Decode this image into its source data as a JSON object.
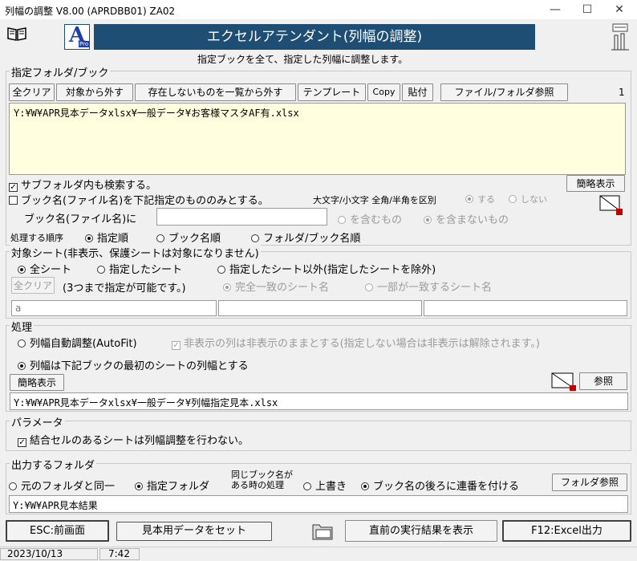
{
  "window": {
    "title": "列幅の調整 V8.00 (APRDBB01)  ZA02",
    "minimize": "—",
    "maximize": "☐",
    "close": "✕"
  },
  "header": {
    "banner": "エクセルアテンダント(列幅の調整)",
    "subtitle": "指定ブックを全て、指定した列幅に調整します。",
    "logo_letter": "A",
    "logo_sub": "Pro"
  },
  "books": {
    "group_label": "指定フォルダ/ブック",
    "btn_clear": "全クリア",
    "btn_remove": "対象から外す",
    "btn_remove_missing": "存在しないものを一覧から外す",
    "btn_template": "テンプレート",
    "btn_copy": "Copy",
    "btn_paste": "貼付",
    "btn_browse": "ファイル/フォルダ参照",
    "count": "1",
    "list": [
      "Y:¥W¥APR見本データxlsx¥一般データ¥お客様マスタAF有.xlsx"
    ],
    "subfolder_label": "サブフォルダ内も検索する。",
    "subfolder_checked": true,
    "btn_simple": "簡略表示",
    "filter_label": "ブック名(ファイル名)を下記指定のもののみとする。",
    "case_label": "大文字/小文字 全角/半角を区別",
    "case_yes": "する",
    "case_no": "しない",
    "bookname_label": "ブック名(ファイル名)に",
    "bookname_value": "",
    "contains": "を含むもの",
    "not_contains": "を含まないもの",
    "order_label": "処理する順序",
    "order_opts": [
      "指定順",
      "ブック名順",
      "フォルダ/ブック名順"
    ]
  },
  "sheets": {
    "group_label": "対象シート(非表示、保護シートは対象になりません)",
    "opt_all": "全シート",
    "opt_specified": "指定したシート",
    "opt_except": "指定したシート以外(指定したシートを除外)",
    "btn_clear": "全クリア",
    "note": "(3つまで指定が可能です。)",
    "exact": "完全一致のシート名",
    "partial": "一部が一致するシート名",
    "fields": [
      "a",
      "",
      ""
    ]
  },
  "process": {
    "group_label": "処理",
    "opt_autofit": "列幅自動調整(AutoFit)",
    "hidden_note": "非表示の列は非表示のままとする(指定しない場合は非表示は解除されます。)",
    "opt_firstsheet": "列幅は下記ブックの最初のシートの列幅とする",
    "btn_simple": "簡略表示",
    "btn_browse": "参照",
    "path": "Y:¥W¥APR見本データxlsx¥一般データ¥列幅指定見本.xlsx"
  },
  "params": {
    "group_label": "パラメータ",
    "merged_label": "結合セルのあるシートは列幅調整を行わない。",
    "merged_checked": true
  },
  "output": {
    "group_label": "出力するフォルダ",
    "opt_same": "元のフォルダと同一",
    "opt_specified": "指定フォルダ",
    "same_name_1": "同じブック名が",
    "same_name_2": "ある時の処理",
    "opt_overwrite": "上書き",
    "opt_serial": "ブック名の後ろに連番を付ける",
    "btn_browse": "フォルダ参照",
    "path": "Y:¥W¥APR見本結果"
  },
  "footer": {
    "btn_esc": "ESC:前画面",
    "btn_sample": "見本用データをセット",
    "btn_prev_result": "直前の実行結果を表示",
    "btn_f12": "F12:Excel出力"
  },
  "statusbar": {
    "date": "2023/10/13",
    "time": "7:42"
  }
}
